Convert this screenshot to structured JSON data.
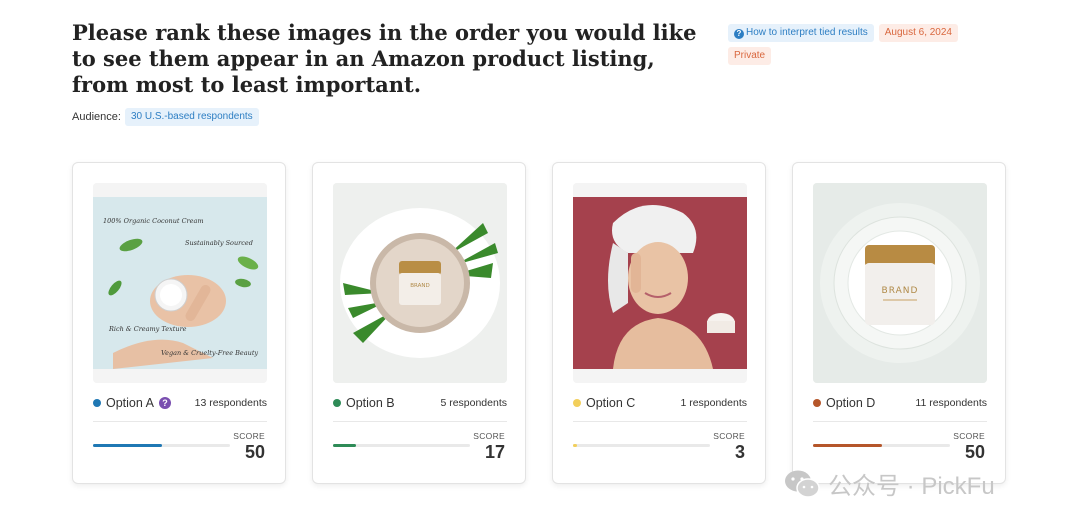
{
  "question": "Please rank these images in the order you would like to see them appear in an Amazon product listing, from most to least important.",
  "audience": {
    "label": "Audience:",
    "value": "30 U.S.-based respondents"
  },
  "meta": {
    "help_link": "How to interpret tied results",
    "date": "August 6, 2024",
    "privacy": "Private"
  },
  "score_label": "SCORE",
  "options": [
    {
      "label": "Option A",
      "respondents": "13 respondents",
      "score": "50",
      "score_fraction": 0.5,
      "color": "#1f78b4",
      "has_help": true,
      "image_texts": [
        "100% Organic Coconut Cream",
        "Sustainably Sourced",
        "Rich & Creamy Texture",
        "Vegan & Cruelty-Free Beauty"
      ]
    },
    {
      "label": "Option B",
      "respondents": "5 respondents",
      "score": "17",
      "score_fraction": 0.17,
      "color": "#2e8b57",
      "has_help": false,
      "image_texts": [
        "BRAND"
      ]
    },
    {
      "label": "Option C",
      "respondents": "1 respondents",
      "score": "3",
      "score_fraction": 0.03,
      "color": "#f2cf5b",
      "has_help": false,
      "image_texts": []
    },
    {
      "label": "Option D",
      "respondents": "11 respondents",
      "score": "50",
      "score_fraction": 0.5,
      "color": "#b5562a",
      "has_help": false,
      "image_texts": [
        "BRAND"
      ]
    }
  ],
  "watermark": {
    "text": "公众号 · PickFu",
    "icon": "wechat-icon"
  }
}
